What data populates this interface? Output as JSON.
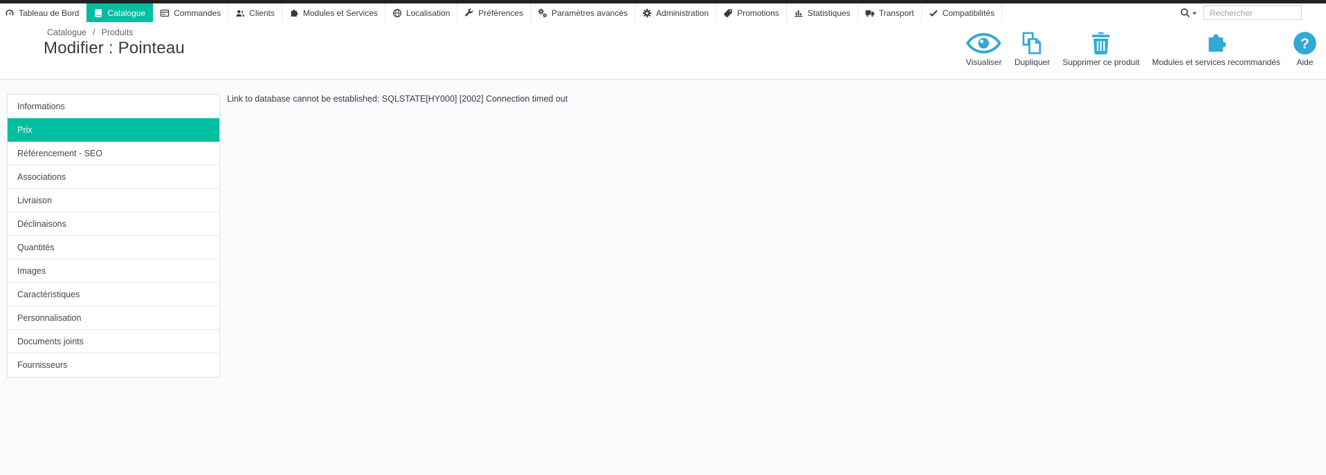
{
  "nav": {
    "items": [
      {
        "label": "Tableau de Bord",
        "icon": "dashboard-icon",
        "active": false
      },
      {
        "label": "Catalogue",
        "icon": "book-icon",
        "active": true
      },
      {
        "label": "Commandes",
        "icon": "orders-icon",
        "active": false
      },
      {
        "label": "Clients",
        "icon": "customers-icon",
        "active": false
      },
      {
        "label": "Modules et Services",
        "icon": "modules-icon",
        "active": false
      },
      {
        "label": "Localisation",
        "icon": "globe-icon",
        "active": false
      },
      {
        "label": "Préférences",
        "icon": "wrench-icon",
        "active": false
      },
      {
        "label": "Paramètres avancés",
        "icon": "gears-icon",
        "active": false
      },
      {
        "label": "Administration",
        "icon": "gear-icon",
        "active": false
      },
      {
        "label": "Promotions",
        "icon": "tag-icon",
        "active": false
      },
      {
        "label": "Statistiques",
        "icon": "stats-icon",
        "active": false
      },
      {
        "label": "Transport",
        "icon": "truck-icon",
        "active": false
      },
      {
        "label": "Compatibilités",
        "icon": "check-icon",
        "active": false
      }
    ],
    "search": {
      "placeholder": "Rechercher",
      "icon": "search-icon",
      "caret_icon": "caret-down-icon"
    }
  },
  "header": {
    "breadcrumb": {
      "items": [
        "Catalogue",
        "Produits"
      ],
      "separator": "/"
    },
    "title": "Modifier : Pointeau",
    "actions": [
      {
        "label": "Visualiser",
        "icon": "eye-icon"
      },
      {
        "label": "Dupliquer",
        "icon": "duplicate-icon"
      },
      {
        "label": "Supprimer ce produit",
        "icon": "trash-icon"
      },
      {
        "label": "Modules et services recommandés",
        "icon": "puzzle-icon"
      },
      {
        "label": "Aide",
        "icon": "help-icon"
      }
    ]
  },
  "sidebar": {
    "tabs": [
      {
        "label": "Informations",
        "active": false
      },
      {
        "label": "Prix",
        "active": true
      },
      {
        "label": "Référencement - SEO",
        "active": false
      },
      {
        "label": "Associations",
        "active": false
      },
      {
        "label": "Livraison",
        "active": false
      },
      {
        "label": "Déclinaisons",
        "active": false
      },
      {
        "label": "Quantités",
        "active": false
      },
      {
        "label": "Images",
        "active": false
      },
      {
        "label": "Caractéristiques",
        "active": false
      },
      {
        "label": "Personnalisation",
        "active": false
      },
      {
        "label": "Documents joints",
        "active": false
      },
      {
        "label": "Fournisseurs",
        "active": false
      }
    ]
  },
  "main": {
    "error_message": "Link to database cannot be established: SQLSTATE[HY000] [2002] Connection timed out"
  },
  "colors": {
    "accent_teal": "#00bfa0",
    "icon_blue": "#31a9d4",
    "topbar_dark": "#1f2225"
  }
}
